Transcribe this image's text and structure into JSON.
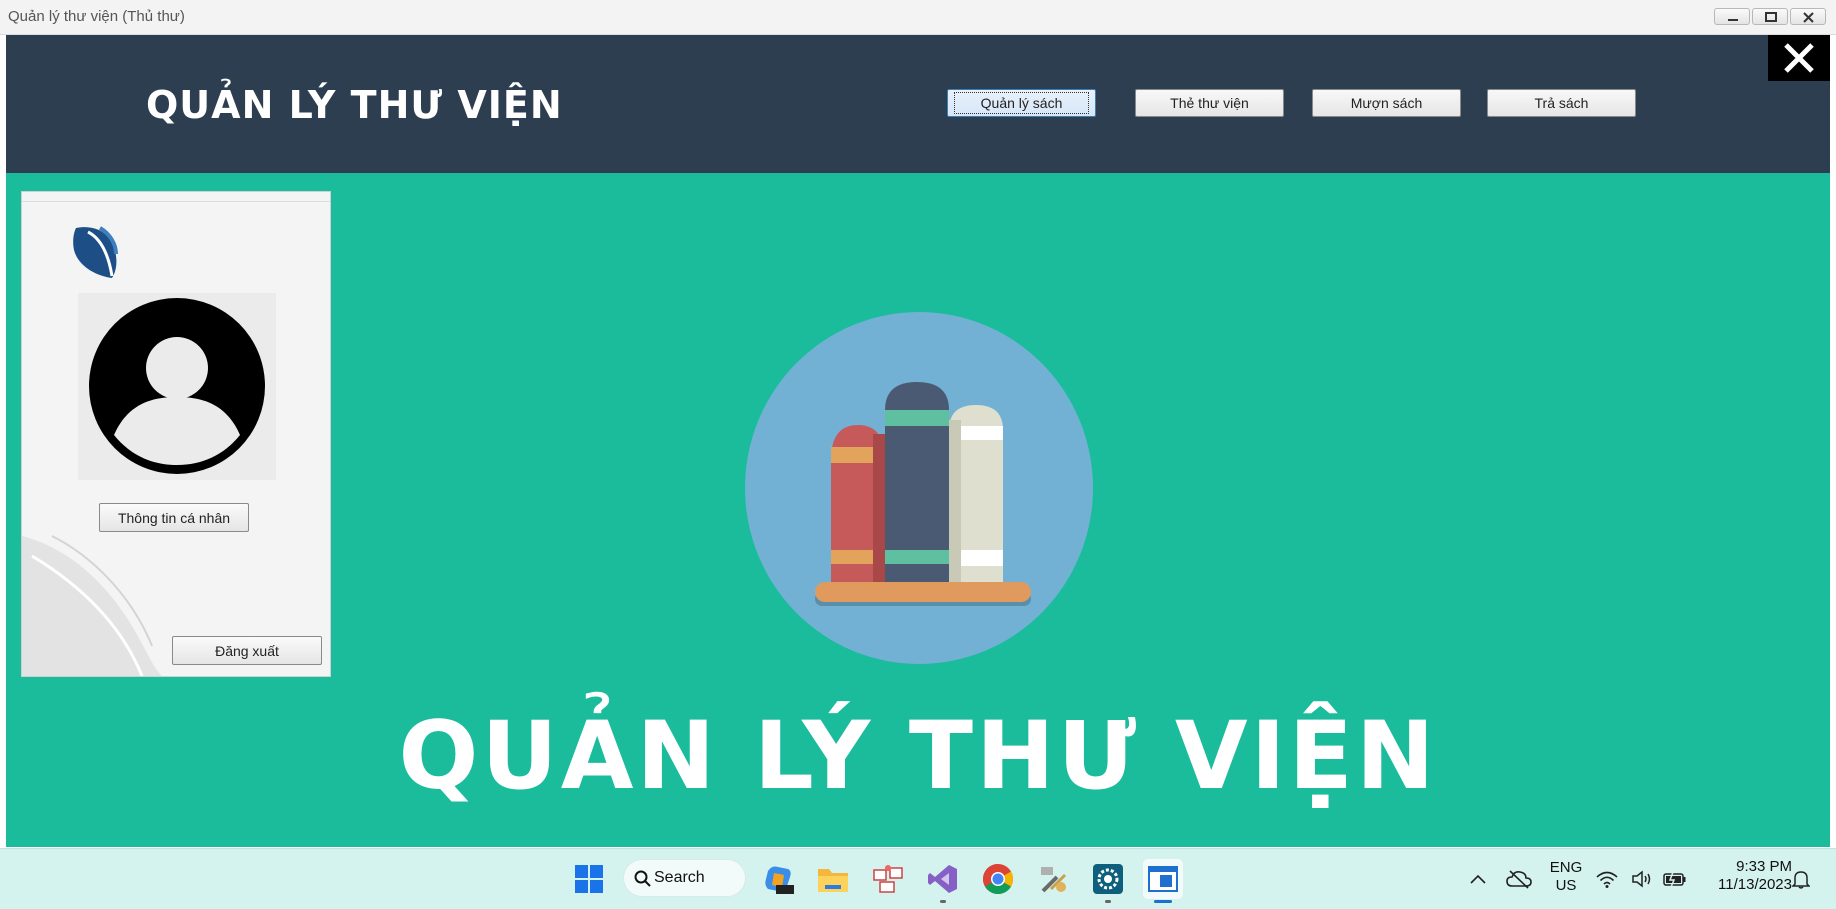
{
  "window": {
    "title": "Quản lý thư viện (Thủ thư)"
  },
  "header": {
    "app_title": "QUẢN LÝ THƯ VIỆN",
    "nav": [
      {
        "label": "Quản lý sách"
      },
      {
        "label": "Thẻ thư viện"
      },
      {
        "label": "Mượn sách"
      },
      {
        "label": "Trả sách"
      }
    ]
  },
  "sidebar": {
    "profile_button": "Thông tin cá nhân",
    "logout_button": "Đăng xuất"
  },
  "main": {
    "hero_title": "QUẢN LÝ THƯ VIỆN"
  },
  "taskbar": {
    "search_label": "Search",
    "language_line1": "ENG",
    "language_line2": "US",
    "time": "9:33 PM",
    "date": "11/13/2023"
  },
  "colors": {
    "header_bg": "#2d3e50",
    "main_bg": "#1abc9c",
    "hero_circle": "#72b1d4"
  }
}
